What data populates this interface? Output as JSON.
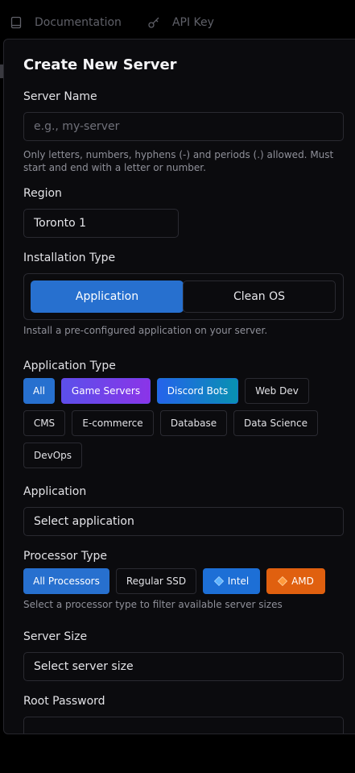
{
  "topnav": {
    "documentation_label": "Documentation",
    "api_key_label": "API Key"
  },
  "modal": {
    "title": "Create New Server",
    "server_name": {
      "label": "Server Name",
      "placeholder": "e.g., my-server",
      "help": "Only letters, numbers, hyphens (-) and periods (.) allowed. Must start and end with a letter or number."
    },
    "region": {
      "label": "Region",
      "value": "Toronto 1"
    },
    "installation_type": {
      "label": "Installation Type",
      "options": [
        "Application",
        "Clean OS"
      ],
      "selected": "Application",
      "help": "Install a pre-configured application on your server."
    },
    "application_type": {
      "label": "Application Type",
      "chips": [
        "All",
        "Game Servers",
        "Discord Bots",
        "Web Dev",
        "CMS",
        "E-commerce",
        "Database",
        "Data Science",
        "DevOps"
      ],
      "selected": "All"
    },
    "application": {
      "label": "Application",
      "value": "Select application"
    },
    "processor_type": {
      "label": "Processor Type",
      "chips": [
        "All Processors",
        "Regular SSD",
        "Intel",
        "AMD"
      ],
      "selected": "All Processors",
      "help": "Select a processor type to filter available server sizes"
    },
    "server_size": {
      "label": "Server Size",
      "value": "Select server size"
    },
    "root_password": {
      "label": "Root Password",
      "value": ""
    }
  },
  "colors": {
    "primary": "#2770cf",
    "game_servers": "#7c3aed",
    "discord_bots": "#0e7ec4",
    "intel": "#1d6fd6",
    "amd": "#e0600f"
  }
}
